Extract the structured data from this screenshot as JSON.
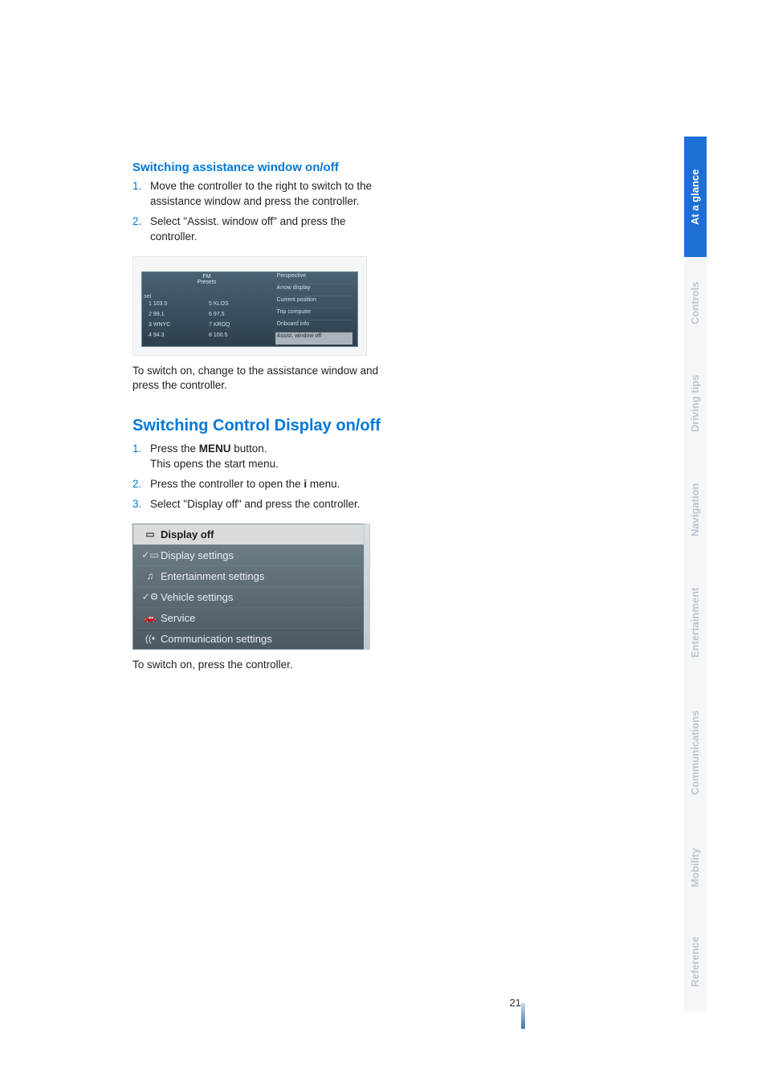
{
  "page_number": "21",
  "section1": {
    "heading": "Switching assistance window on/off",
    "steps": [
      {
        "num": "1.",
        "text": "Move the controller to the right to switch to the assistance window and press the controller."
      },
      {
        "num": "2.",
        "text": "Select \"Assist. window off\" and press the controller."
      }
    ],
    "after_image_text": "To switch on, change to the assistance window and press the controller."
  },
  "shot1": {
    "band_label": "FM",
    "sub_label": "Presets",
    "set_label": "set",
    "presets": [
      {
        "slot": "1",
        "value": "103.5"
      },
      {
        "slot": "5",
        "value": "KLOS"
      },
      {
        "slot": "2",
        "value": "99.1"
      },
      {
        "slot": "6",
        "value": "97.5"
      },
      {
        "slot": "3",
        "value": "WNYC"
      },
      {
        "slot": "7",
        "value": "KROQ"
      },
      {
        "slot": "4",
        "value": "94.3"
      },
      {
        "slot": "8",
        "value": "100.5"
      }
    ],
    "right_list": [
      "Perspective",
      "Arrow display",
      "Current position",
      "Trip computer",
      "Onboard info"
    ],
    "right_list_highlight": "Assist. window off",
    "overflow_hint": "▾"
  },
  "section2": {
    "heading": "Switching Control Display on/off",
    "steps": [
      {
        "num": "1.",
        "text_pre": "Press the ",
        "strong": "MENU",
        "text_post": " button.",
        "line2": "This opens the start menu."
      },
      {
        "num": "2.",
        "text_pre": "Press the controller to open the ",
        "strong": "i",
        "text_post": " menu."
      },
      {
        "num": "3.",
        "text": "Select \"Display off\" and press the controller."
      }
    ],
    "after_image_text": "To switch on, press the controller."
  },
  "shot2_menu": [
    {
      "icon": "▭",
      "label": "Display off",
      "active": true
    },
    {
      "icon": "✓▭",
      "label": "Display settings"
    },
    {
      "icon": "♫",
      "label": "Entertainment settings"
    },
    {
      "icon": "✓⚙",
      "label": "Vehicle settings"
    },
    {
      "icon": "🚗",
      "label": "Service"
    },
    {
      "icon": "((•",
      "label": "Communication settings"
    }
  ],
  "tabs": [
    {
      "label": "At a glance",
      "active": true
    },
    {
      "label": "Controls",
      "active": false
    },
    {
      "label": "Driving tips",
      "active": false
    },
    {
      "label": "Navigation",
      "active": false
    },
    {
      "label": "Entertainment",
      "active": false
    },
    {
      "label": "Communications",
      "active": false
    },
    {
      "label": "Mobility",
      "active": false
    },
    {
      "label": "Reference",
      "active": false
    }
  ]
}
